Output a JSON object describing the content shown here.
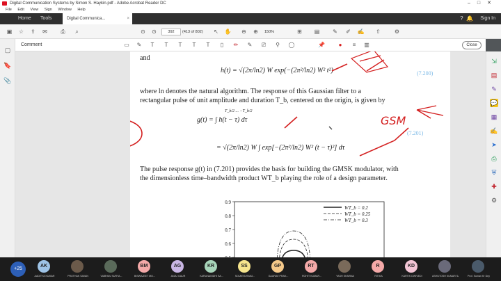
{
  "window": {
    "title": "Digital Communication Systems by Simon S. Haykin.pdf - Adobe Acrobat Reader DC"
  },
  "menu": [
    "File",
    "Edit",
    "View",
    "Sign",
    "Window",
    "Help"
  ],
  "tabs": {
    "home": "Home",
    "tools": "Tools",
    "document": "Digital Communica...",
    "signin": "Sign In"
  },
  "toolbar": {
    "page_current": "392",
    "page_count": "(413 of 802)",
    "zoom": "150%"
  },
  "comment_bar": {
    "label": "Comment",
    "close": "Close"
  },
  "page": {
    "line_and": "and",
    "eq_h": "h(t) = √(2π/ln2) W exp(−(2π²/ln2) W² t²)",
    "eq_h_num": "(7.200)",
    "para1_l1": "where ln denotes the natural algorithm. The response of this Gaussian filter to a",
    "para1_l2": "rectangular pulse of unit amplitude and duration T_b, centered on the origin, is given by",
    "eq_g1": "g(t) = ∫ h(t − τ) dτ",
    "eq_g1_lims": "T_b/2 ... −T_b/2",
    "eq_g2": "= √(2π/ln2) W ∫ exp[−(2π²/ln2) W² (t − τ)²] dτ",
    "eq_g_num": "(7.201)",
    "para2_l1": "The pulse response g(t) in (7.201) provides the basis for building the GMSK modulator, with",
    "para2_l2": "the dimensionless time–bandwidth product WT_b playing the role of a design parameter.",
    "annotation_circle": "2",
    "annotation_gsm": "GSM"
  },
  "chart_data": {
    "type": "line",
    "ylim": [
      0.5,
      0.9
    ],
    "yticks": [
      "0.9",
      "0.8",
      "0.7",
      "0.6",
      "0.5"
    ],
    "legend": [
      "WT_b = 0.2",
      "WT_b = 0.25",
      "WT_b = 0.3"
    ],
    "series": [
      {
        "name": "WT_b = 0.2",
        "peak": 0.55
      },
      {
        "name": "WT_b = 0.25",
        "peak": 0.63
      },
      {
        "name": "WT_b = 0.3",
        "peak": 0.69
      }
    ]
  },
  "participants": {
    "more": "+25",
    "people": [
      {
        "initials": "AK",
        "name": "AADITYA KUMAR",
        "color": "#9ec3e6"
      },
      {
        "initials": "",
        "name": "PRUTHAK SAVAN",
        "color": "#6b5a4a"
      },
      {
        "initials": "",
        "name": "VAIBHAV SURYA...",
        "color": "#5a6a5a"
      },
      {
        "initials": "BM",
        "name": "BISWAJEET MO...",
        "color": "#f4a9a8"
      },
      {
        "initials": "AG",
        "name": "ANJU GAUR",
        "color": "#c9b6e4"
      },
      {
        "initials": "KR",
        "name": "KARUNANIDHI SA...",
        "color": "#a8d5ba"
      },
      {
        "initials": "SS",
        "name": "SOUMYA RANJ...",
        "color": "#f6e58d"
      },
      {
        "initials": "GP",
        "name": "GAURAV PRAK...",
        "color": "#f5c98a"
      },
      {
        "initials": "RT",
        "name": "ROHIT KUMAR...",
        "color": "#f4a9a8"
      },
      {
        "initials": "",
        "name": "YASH SHARMA",
        "color": "#7a6a5a"
      },
      {
        "initials": "R",
        "name": "RITIKA",
        "color": "#f4a9a8"
      },
      {
        "initials": "KD",
        "name": "KARTIK DWIVEDI",
        "color": "#f4c6d6"
      },
      {
        "initials": "",
        "name": "ASHUTOSH KUMAR SAHOO",
        "color": "#6a6a7a"
      },
      {
        "initials": "",
        "name": "Prof. Suman Kr Dey",
        "color": "#4a5a6a"
      }
    ]
  }
}
